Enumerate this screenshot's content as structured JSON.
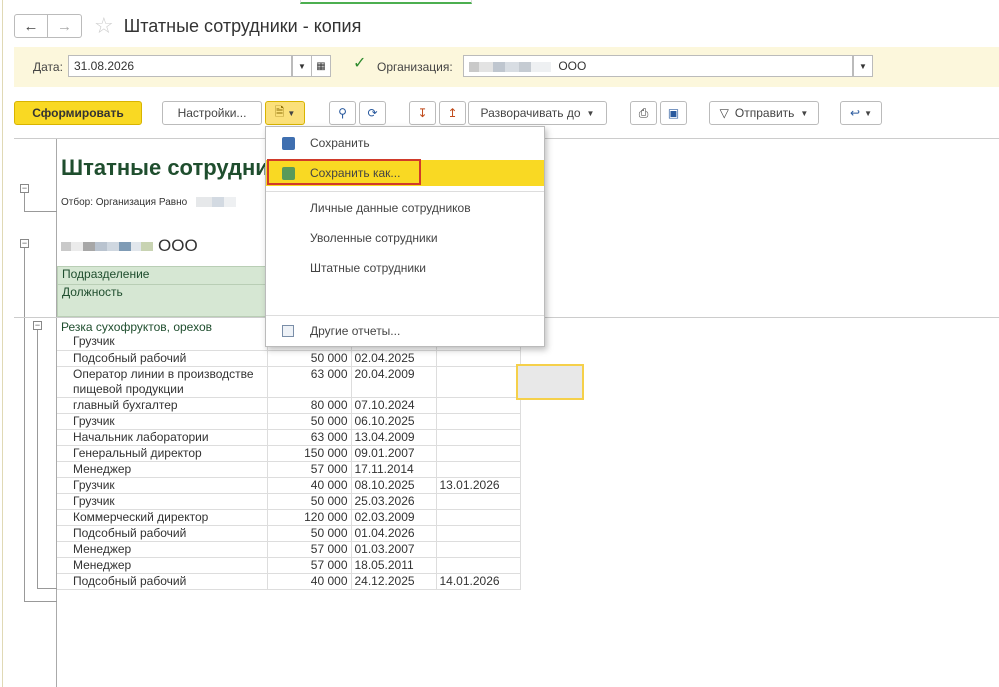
{
  "window": {
    "title": "Штатные сотрудники - копия"
  },
  "params": {
    "date_label": "Дата:",
    "date_value": "31.08.2026",
    "org_label": "Организация:",
    "org_value": "ООО"
  },
  "toolbar": {
    "generate": "Сформировать",
    "settings": "Настройки...",
    "expand_to": "Разворачивать до",
    "send": "Отправить"
  },
  "report": {
    "title": "Штатные сотрудни",
    "filter": "Отбор: Организация Равно",
    "org_name": "ООО",
    "header_col1": "Подразделение",
    "header_col2": "Должность",
    "group": "Резка сухофруктов, орехов",
    "rows": [
      {
        "pos": "Грузчик",
        "sal": "",
        "d1": "",
        "d2": ""
      },
      {
        "pos": "Подсобный рабочий",
        "sal": "50 000",
        "d1": "02.04.2025",
        "d2": ""
      },
      {
        "pos": "Оператор линии в производстве\nпищевой продукции",
        "sal": "63 000",
        "d1": "20.04.2009",
        "d2": ""
      },
      {
        "pos": "главный бухгалтер",
        "sal": "80 000",
        "d1": "07.10.2024",
        "d2": ""
      },
      {
        "pos": "Грузчик",
        "sal": "50 000",
        "d1": "06.10.2025",
        "d2": ""
      },
      {
        "pos": "Начальник лаборатории",
        "sal": "63 000",
        "d1": "13.04.2009",
        "d2": ""
      },
      {
        "pos": "Генеральный директор",
        "sal": "150 000",
        "d1": "09.01.2007",
        "d2": ""
      },
      {
        "pos": "Менеджер",
        "sal": "57 000",
        "d1": "17.11.2014",
        "d2": ""
      },
      {
        "pos": "Грузчик",
        "sal": "40 000",
        "d1": "08.10.2025",
        "d2": "13.01.2026"
      },
      {
        "pos": "Грузчик",
        "sal": "50 000",
        "d1": "25.03.2026",
        "d2": ""
      },
      {
        "pos": "Коммерческий директор",
        "sal": "120 000",
        "d1": "02.03.2009",
        "d2": ""
      },
      {
        "pos": "Подсобный рабочий",
        "sal": "50 000",
        "d1": "01.04.2026",
        "d2": ""
      },
      {
        "pos": "Менеджер",
        "sal": "57 000",
        "d1": "01.03.2007",
        "d2": ""
      },
      {
        "pos": "Менеджер",
        "sal": "57 000",
        "d1": "18.05.2011",
        "d2": ""
      },
      {
        "pos": "Подсобный рабочий",
        "sal": "40 000",
        "d1": "24.12.2025",
        "d2": "14.01.2026"
      }
    ]
  },
  "menu": {
    "save": "Сохранить",
    "save_as": "Сохранить как...",
    "item3": "Личные данные сотрудников",
    "item4": "Уволенные сотрудники",
    "item5": "Штатные сотрудники",
    "other": "Другие отчеты..."
  }
}
